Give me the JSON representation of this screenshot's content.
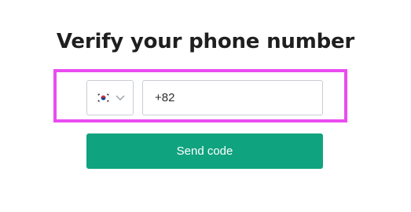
{
  "title": "Verify your phone number",
  "country_select": {
    "flag_icon": "south-korea-flag-icon",
    "chevron_icon": "chevron-down-icon"
  },
  "phone_input": {
    "value": "+82",
    "placeholder": ""
  },
  "send_button": {
    "label": "Send code"
  },
  "colors": {
    "accent": "#10a37f",
    "highlight": "#ea4cf0",
    "border": "#c9cdd2",
    "title": "#1f1f1f"
  }
}
